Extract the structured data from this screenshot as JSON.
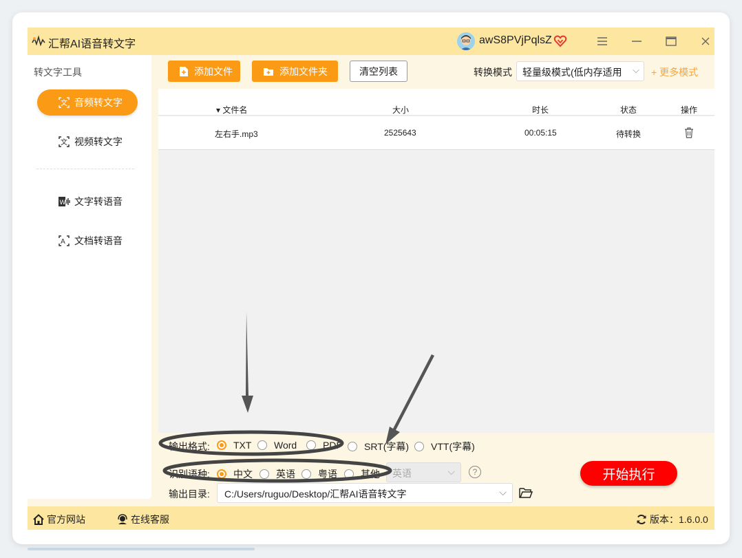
{
  "app": {
    "title": "汇帮AI语音转文字",
    "username": "awS8PVjPqlsZ",
    "window_controls": [
      "menu-icon",
      "minimize-icon",
      "maximize-icon",
      "close-icon"
    ]
  },
  "sidebar": {
    "heading": "转文字工具",
    "items": [
      {
        "label": "音频转文字",
        "icon": "audio-to-text-icon",
        "active": true
      },
      {
        "label": "视频转文字",
        "icon": "video-to-text-icon",
        "active": false
      },
      {
        "label": "文字转语音",
        "icon": "text-to-speech-icon",
        "active": false
      },
      {
        "label": "文档转语音",
        "icon": "document-to-speech-icon",
        "active": false
      }
    ]
  },
  "toolbar": {
    "add_file": "添加文件",
    "add_folder": "添加文件夹",
    "clear_list": "清空列表",
    "mode_label": "转换模式",
    "mode_value": "轻量级模式(低内存适用",
    "more_modes": "+ 更多模式"
  },
  "table": {
    "headers": {
      "name": "▾ 文件名",
      "size": "大小",
      "duration": "时长",
      "status": "状态",
      "action": "操作"
    },
    "rows": [
      {
        "name": "左右手.mp3",
        "size": "2525643",
        "duration": "00:05:15",
        "status": "待转换"
      }
    ]
  },
  "settings": {
    "output_format_label": "输出格式:",
    "output_formats": [
      "TXT",
      "Word",
      "PDF",
      "SRT(字幕)",
      "VTT(字幕)"
    ],
    "output_format_selected": "TXT",
    "language_label": "识别语种:",
    "languages": [
      "中文",
      "英语",
      "粤语",
      "其他"
    ],
    "language_selected": "中文",
    "other_language_value": "英语",
    "output_dir_label": "输出目录:",
    "output_dir_value": "C:/Users/ruguo/Desktop/汇帮AI语音转文字",
    "start_button": "开始执行"
  },
  "footer": {
    "website": "官方网站",
    "support": "在线客服",
    "version": "版本：1.6.0.0"
  },
  "colors": {
    "accent": "#fb9a14",
    "titlebar": "#fde7a0",
    "start": "#ff0000"
  }
}
